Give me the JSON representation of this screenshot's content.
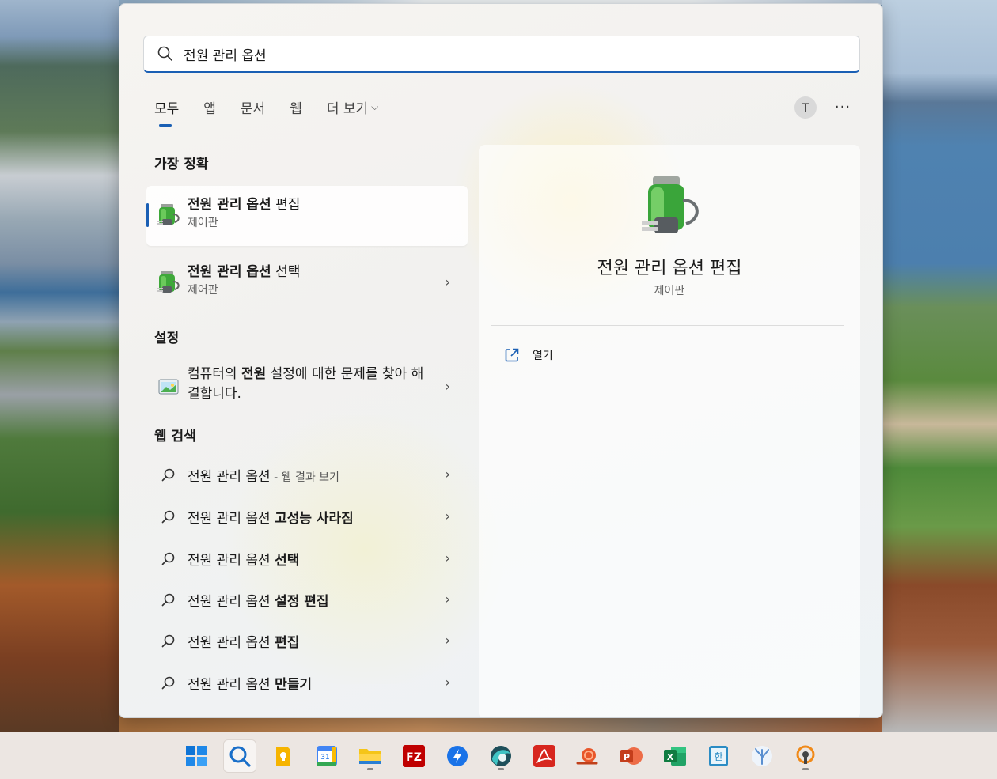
{
  "search": {
    "value": "전원 관리 옵션"
  },
  "tabs": [
    {
      "label": "모두"
    },
    {
      "label": "앱"
    },
    {
      "label": "문서"
    },
    {
      "label": "웹"
    },
    {
      "label": "더 보기"
    }
  ],
  "account": {
    "initial": "T"
  },
  "more_label": "···",
  "sections": {
    "best_match": "가장 정확",
    "settings": "설정",
    "web_search": "웹 검색"
  },
  "best_match": [
    {
      "title_bold": "전원 관리 옵션",
      "title_rest": " 편집",
      "subtitle": "제어판"
    },
    {
      "title_bold": "전원 관리 옵션",
      "title_rest": " 선택",
      "subtitle": "제어판"
    }
  ],
  "settings_item": {
    "text_before": "컴퓨터의 ",
    "text_bold": "전원",
    "text_after": " 설정에 대한 문제를 찾아 해결합니다."
  },
  "web_results": [
    {
      "prefix": "전원 관리 옵션",
      "bold": "",
      "suffix": " - 웹 결과 보기"
    },
    {
      "prefix": "전원 관리 옵션 ",
      "bold": "고성능 사라짐",
      "suffix": ""
    },
    {
      "prefix": "전원 관리 옵션 ",
      "bold": "선택",
      "suffix": ""
    },
    {
      "prefix": "전원 관리 옵션 ",
      "bold": "설정 편집",
      "suffix": ""
    },
    {
      "prefix": "전원 관리 옵션 ",
      "bold": "편집",
      "suffix": ""
    },
    {
      "prefix": "전원 관리 옵션 ",
      "bold": "만들기",
      "suffix": ""
    }
  ],
  "preview": {
    "title": "전원 관리 옵션 편집",
    "subtitle": "제어판",
    "open_label": "열기"
  },
  "taskbar": {
    "apps": [
      "windows-start-icon",
      "search-icon",
      "keep-notes-icon",
      "calendar-icon",
      "file-explorer-icon",
      "filezilla-icon",
      "messenger-icon",
      "browser-icon",
      "acrobat-icon",
      "snail-icon",
      "powerpoint-icon",
      "excel-icon",
      "hwp-icon",
      "coral-icon",
      "vpn-icon"
    ],
    "calendar_day": "31",
    "hwp_glyph": "한",
    "filezilla_glyph": "FZ",
    "excel_glyph": "X",
    "powerpoint_glyph": "P"
  },
  "colors": {
    "accent": "#1a5fb4"
  }
}
